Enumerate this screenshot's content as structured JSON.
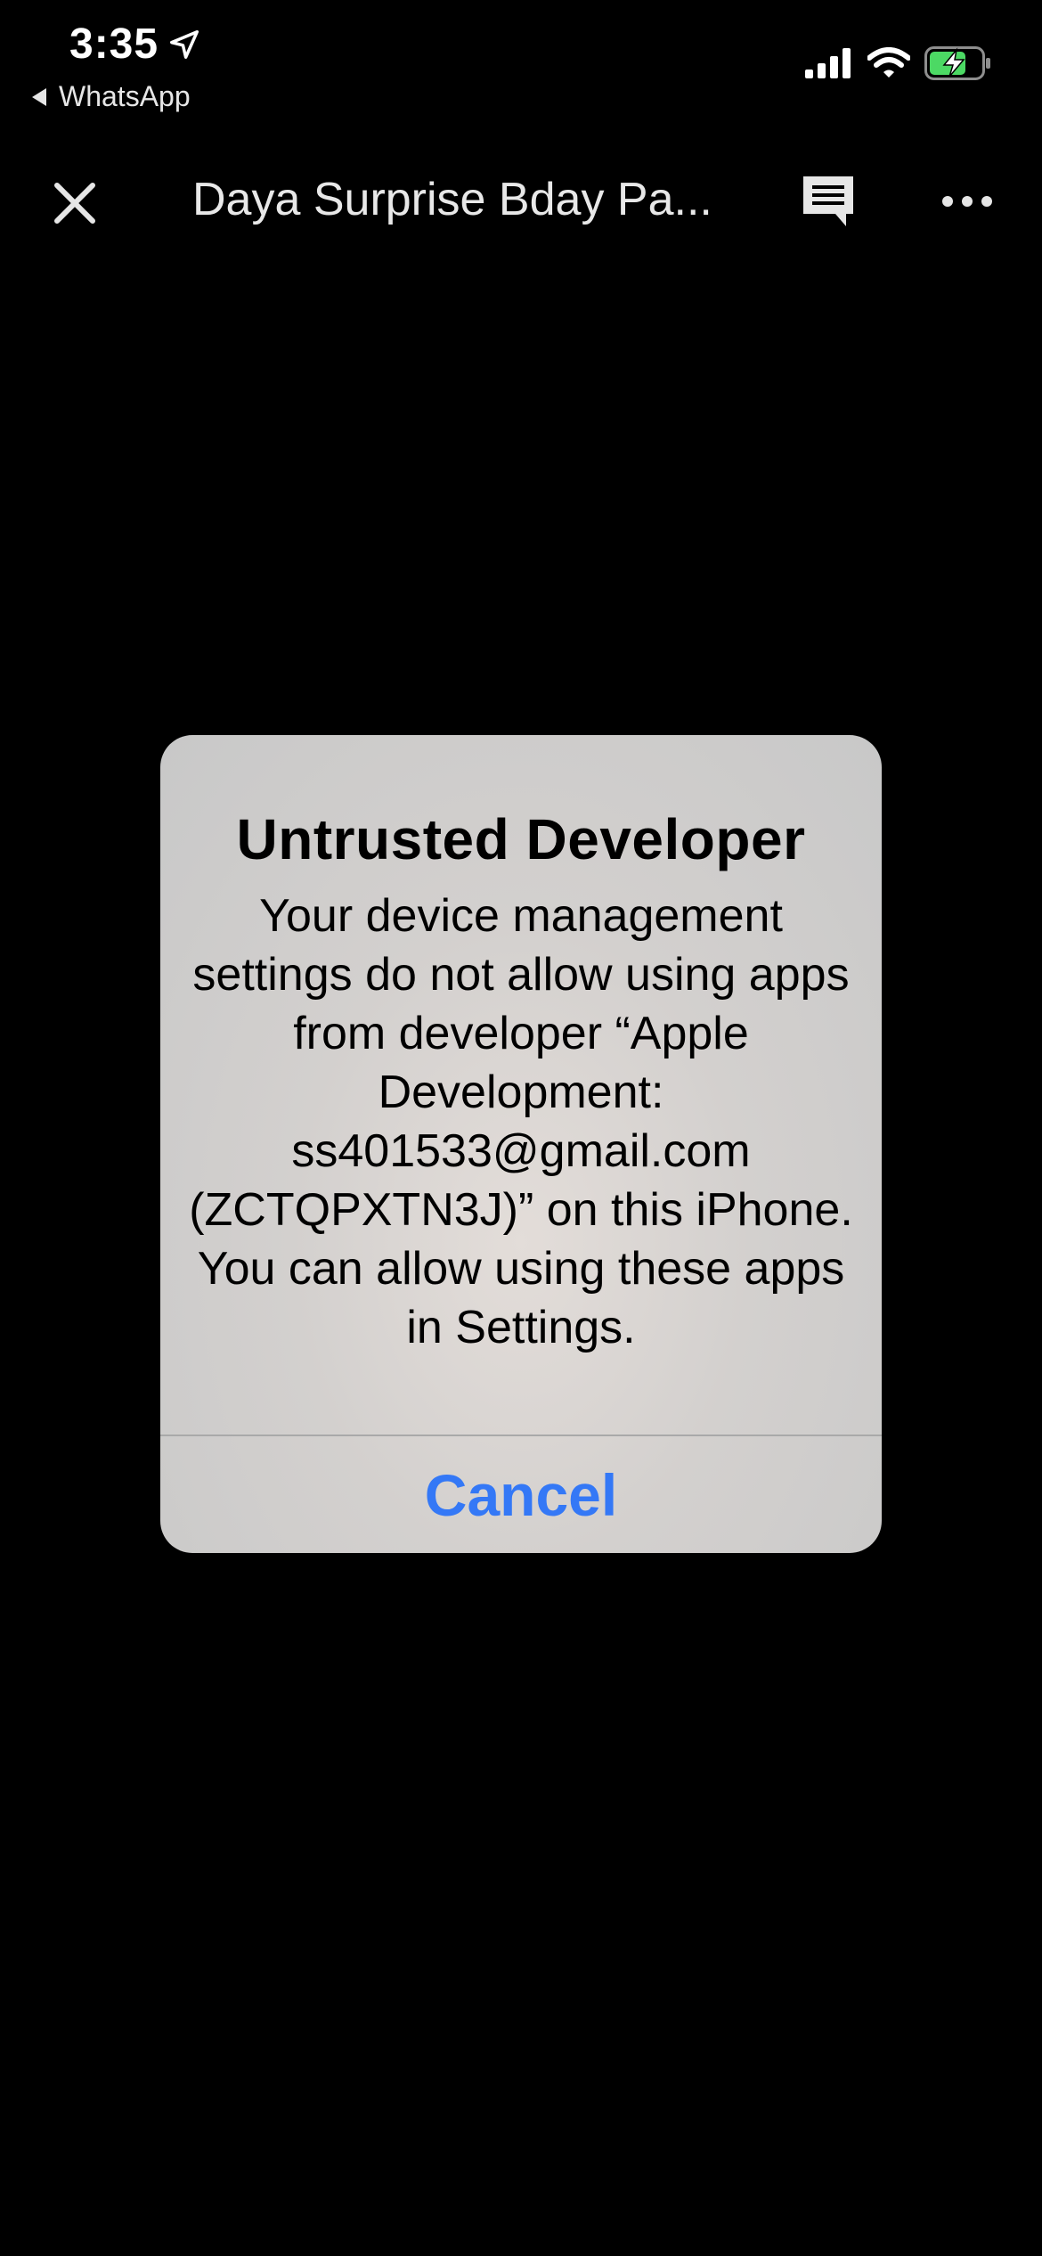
{
  "status_bar": {
    "time": "3:35",
    "back_app": "WhatsApp",
    "location_icon": "location-arrow-icon",
    "signal_icon": "cellular-signal-icon",
    "wifi_icon": "wifi-icon",
    "battery_icon": "battery-charging-icon",
    "battery_color": "#4cd964"
  },
  "nav": {
    "close_icon": "close-icon",
    "title": "Daya Surprise Bday Pa...",
    "comment_icon": "comment-icon",
    "more_icon": "more-icon"
  },
  "alert": {
    "title": "Untrusted Developer",
    "message": "Your device management settings do not allow using apps from developer “Apple Development: ss401533@gmail.com (ZCTQPXTN3J)” on this iPhone. You can allow using these apps in Settings.",
    "cancel_label": "Cancel",
    "accent_color": "#3478f6"
  }
}
